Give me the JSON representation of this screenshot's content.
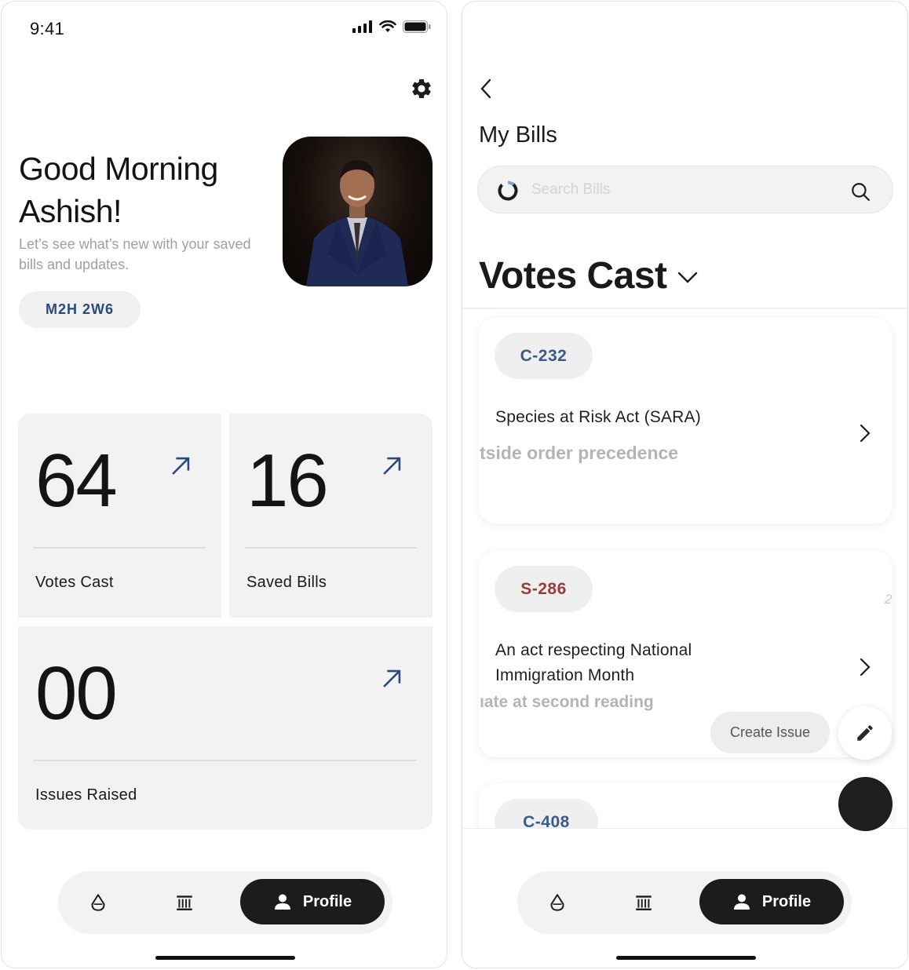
{
  "status_bar": {
    "time": "9:41"
  },
  "home": {
    "greeting_line1": "Good Morning",
    "greeting_line2": "Ashish!",
    "subtext": "Let’s see what’s new with your saved bills and updates.",
    "postal_code": "M2H 2W6",
    "stats": [
      {
        "value": "64",
        "label": "Votes Cast"
      },
      {
        "value": "16",
        "label": "Saved Bills"
      },
      {
        "value": "00",
        "label": "Issues Raised"
      }
    ]
  },
  "nav": {
    "profile_label": "Profile"
  },
  "bills_page": {
    "title": "My Bills",
    "search_placeholder": "Search Bills",
    "section_title": "Votes Cast",
    "bills": [
      {
        "code": "C-232",
        "code_color": "#3a5a8c",
        "title": "Species at Risk Act (SARA)",
        "status": "tside order precedence"
      },
      {
        "code": "S-286",
        "code_color": "#9b3a3a",
        "title": "An act respecting National Immigration Month",
        "status": "ıate at second reading"
      },
      {
        "code": "C-408",
        "code_color": "#3a5a8c"
      }
    ],
    "create_issue_label": "Create Issue",
    "stray_glyph": "2"
  },
  "colors": {
    "accent_blue": "#2b4a7a",
    "dark": "#1c1c1c",
    "card_bg": "#f2f2f2"
  }
}
